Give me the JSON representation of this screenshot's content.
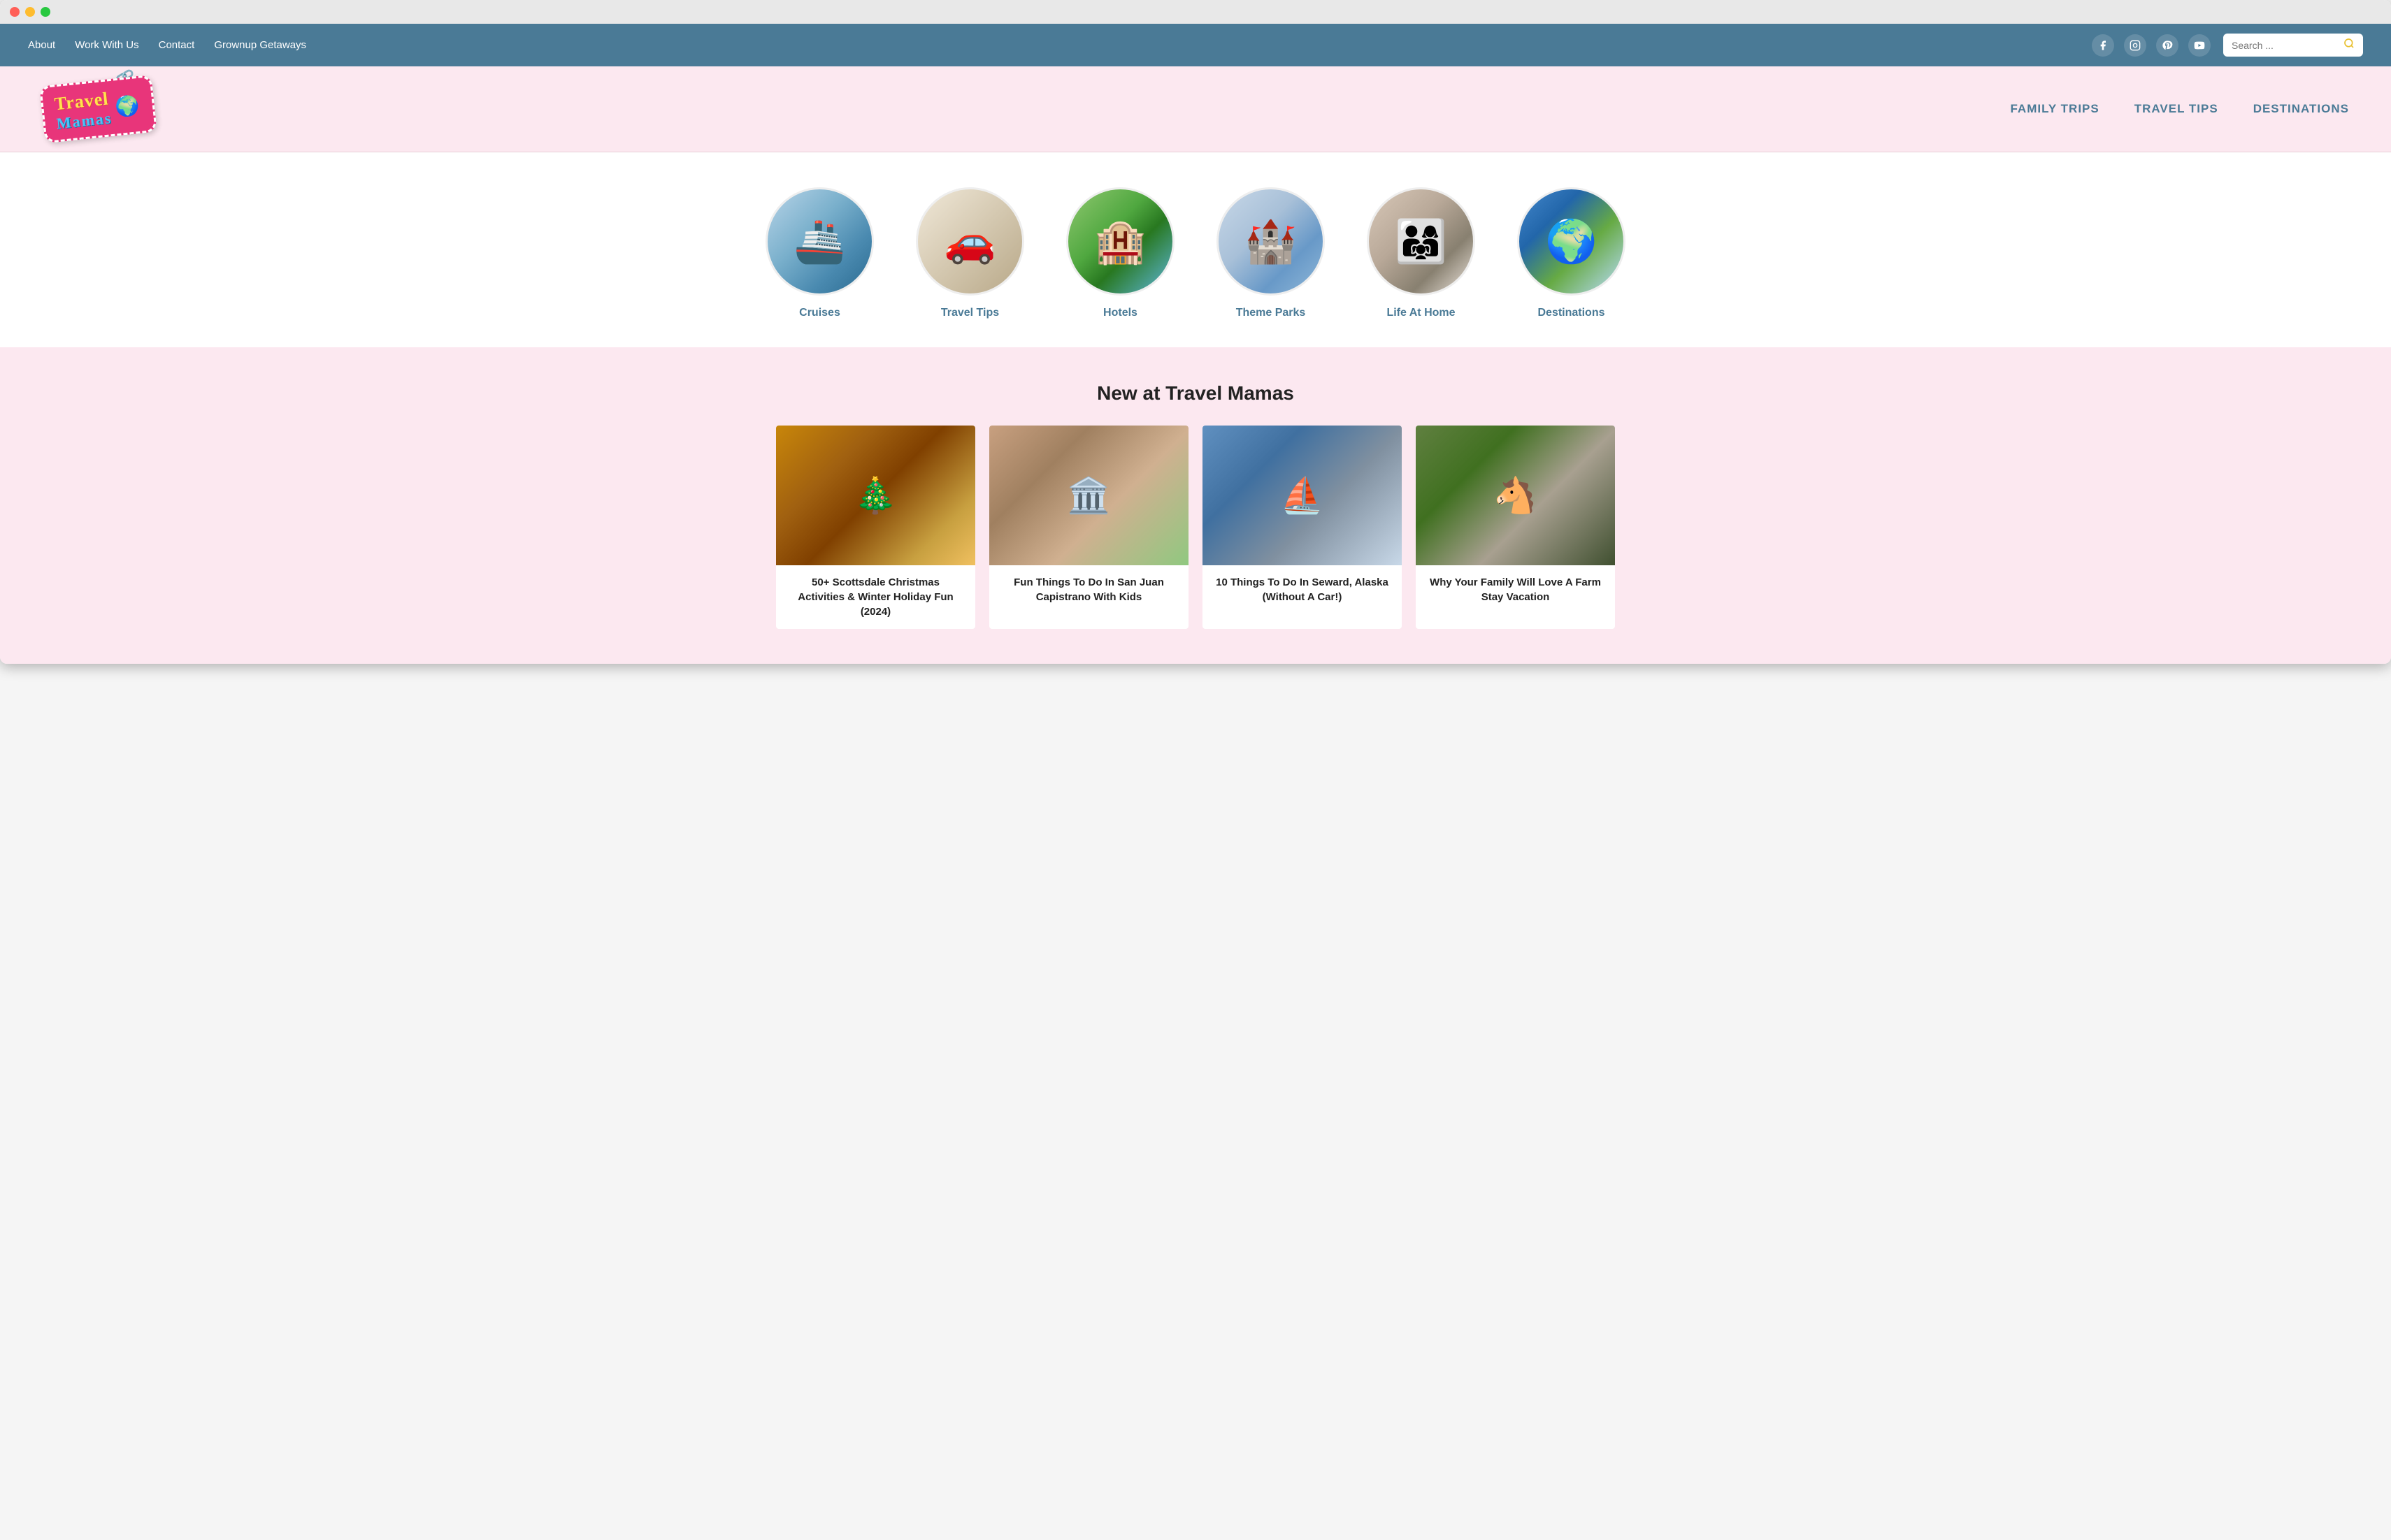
{
  "browser": {
    "dot_red": "red",
    "dot_yellow": "yellow",
    "dot_green": "green"
  },
  "topnav": {
    "links": [
      {
        "label": "About",
        "key": "about"
      },
      {
        "label": "Work With Us",
        "key": "work-with-us"
      },
      {
        "label": "Contact",
        "key": "contact"
      },
      {
        "label": "Grownup Getaways",
        "key": "grownup-getaways"
      }
    ],
    "search_placeholder": "Search ...",
    "search_label": "Search"
  },
  "header": {
    "logo_travel": "Travel",
    "logo_mamas": "Mamas",
    "nav_links": [
      {
        "label": "FAMILY TRIPS",
        "key": "family-trips"
      },
      {
        "label": "TRAVEL TIPS",
        "key": "travel-tips"
      },
      {
        "label": "DESTINATIONS",
        "key": "destinations"
      }
    ]
  },
  "categories": [
    {
      "label": "Cruises",
      "key": "cruises",
      "emoji": "🚢",
      "class": "circle-cruises"
    },
    {
      "label": "Travel Tips",
      "key": "travel-tips",
      "emoji": "🚗",
      "class": "circle-travel-tips"
    },
    {
      "label": "Hotels",
      "key": "hotels",
      "emoji": "🏨",
      "class": "circle-hotels"
    },
    {
      "label": "Theme Parks",
      "key": "theme-parks",
      "emoji": "🏰",
      "class": "circle-theme-parks"
    },
    {
      "label": "Life At Home",
      "key": "life-at-home",
      "emoji": "👨‍👩‍👧‍👦",
      "class": "circle-life-at-home"
    },
    {
      "label": "Destinations",
      "key": "destinations",
      "emoji": "🌍",
      "class": "circle-destinations"
    }
  ],
  "new_section": {
    "title": "New at Travel Mamas",
    "articles": [
      {
        "key": "scottsdale",
        "img_class": "img-scottsdale",
        "emoji": "🎄",
        "title": "50+ Scottsdale Christmas Activities & Winter Holiday Fun (2024)"
      },
      {
        "key": "capistrano",
        "img_class": "img-capistrano",
        "emoji": "🏛️",
        "title": "Fun Things To Do In San Juan Capistrano With Kids"
      },
      {
        "key": "seward",
        "img_class": "img-seward",
        "emoji": "⛵",
        "title": "10 Things To Do In Seward, Alaska (Without A Car!)"
      },
      {
        "key": "farm-stay",
        "img_class": "img-farm",
        "emoji": "🐴",
        "title": "Why Your Family Will Love A Farm Stay Vacation"
      }
    ]
  }
}
